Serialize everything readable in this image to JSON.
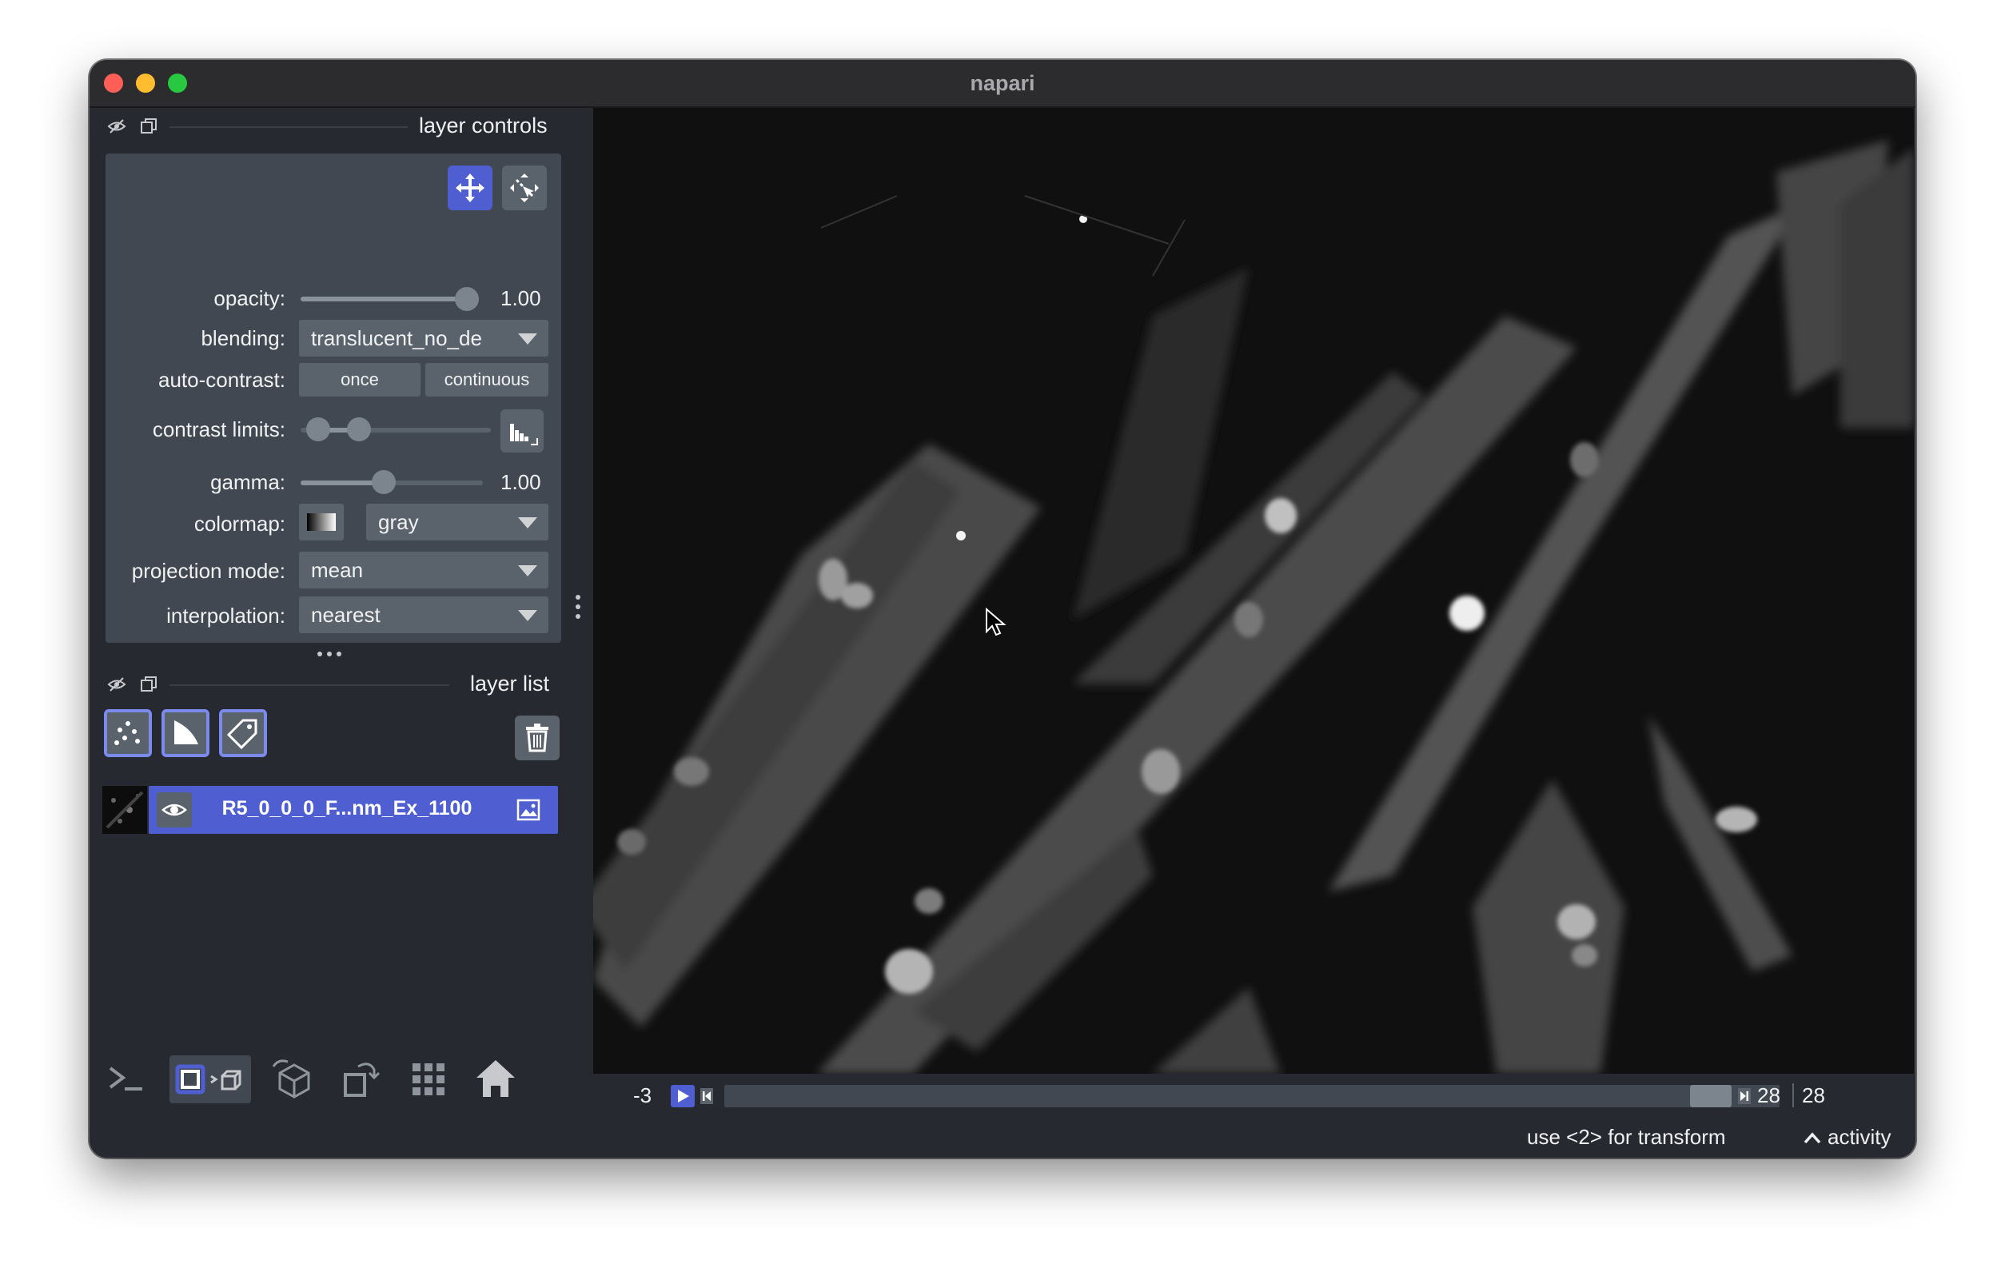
{
  "window": {
    "title": "napari",
    "traffic_lights": {
      "close": "#ff5f57",
      "minimize": "#febc2e",
      "zoom": "#28c840"
    }
  },
  "layer_controls": {
    "title": "layer controls",
    "opacity": {
      "label": "opacity:",
      "value": "1.00",
      "fraction": 1.0
    },
    "blending": {
      "label": "blending:",
      "value": "translucent_no_de"
    },
    "auto_contrast": {
      "label": "auto-contrast:",
      "once": "once",
      "continuous": "continuous"
    },
    "contrast_limits": {
      "label": "contrast limits:"
    },
    "gamma": {
      "label": "gamma:",
      "value": "1.00"
    },
    "colormap": {
      "label": "colormap:",
      "value": "gray"
    },
    "projection_mode": {
      "label": "projection mode:",
      "value": "mean"
    },
    "interpolation": {
      "label": "interpolation:",
      "value": "nearest"
    }
  },
  "layer_list": {
    "title": "layer list",
    "layers": [
      {
        "name": "R5_0_0_0_F...nm_Ex_1100",
        "visible": true,
        "selected": true
      }
    ]
  },
  "dims": {
    "left_value": "-3",
    "right_value": "28",
    "total": "28"
  },
  "status_bar": {
    "message": "use <2> for transform",
    "activity": "activity"
  },
  "colors": {
    "window_bg": "#262930",
    "panel_bg": "#414851",
    "accent": "#7b8bec",
    "selected_layer": "#4f5fd1",
    "text": "#f0f1f2"
  }
}
